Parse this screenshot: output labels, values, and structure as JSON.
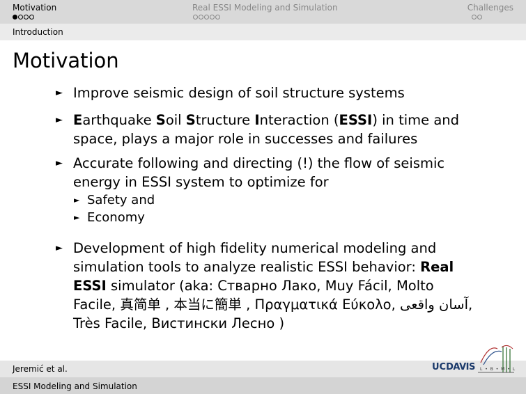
{
  "headline": {
    "sections": [
      {
        "label": "Motivation",
        "dots_total": 4,
        "dots_filled": 1
      },
      {
        "label": "Real ESSI Modeling and Simulation",
        "dots_total": 5,
        "dots_filled": 0
      },
      {
        "label": "Challenges",
        "dots_total": 2,
        "dots_filled": 0
      }
    ]
  },
  "subsection": "Introduction",
  "frame_title": "Motivation",
  "bullets": {
    "b1": "Improve seismic design of soil structure systems",
    "b2": {
      "E": "E",
      "arthquake": "arthquake ",
      "S1": "S",
      "oil": "oil ",
      "S2": "S",
      "tructure": "tructure ",
      "I": "I",
      "nteraction": "nteraction (",
      "ESSI": "ESSI",
      "rest": ") in time and space, plays a major role in successes and failures"
    },
    "b3": {
      "text": "Accurate following and directing (!) the flow of seismic energy in ESSI system to optimize for",
      "sub": [
        "Safety and",
        "Economy"
      ]
    },
    "b4": {
      "text": "Development of high fidelity numerical modeling and simulation tools to analyze realistic ESSI behavior:",
      "real_essi": "Real ESSI",
      "rest": " simulator (aka: Стварно Лако,  Muy Fácil, Molto Facile,  真简单 , 本当に簡単 , Πραγματικά Εύκολο, آسان واقعی, Très Facile, Вистински Лесно )"
    }
  },
  "footer": {
    "author": "Jeremić et al.",
    "title": "ESSI Modeling and Simulation",
    "ucdavis_uc": "UC",
    "ucdavis_davis": "DAVIS",
    "lbml": "L • B • M • L"
  },
  "colors": {
    "headline_bg": "#d9d9d9",
    "sub_bg": "#ebebeb",
    "footer_bg1": "#e6e6e6",
    "footer_bg2": "#d4d4d4",
    "ucdavis_blue": "#1b3a6b"
  }
}
